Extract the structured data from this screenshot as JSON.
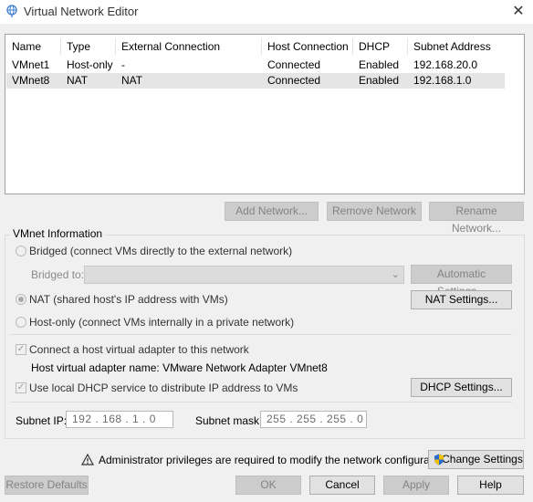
{
  "window": {
    "title": "Virtual Network Editor",
    "close_glyph": "✕",
    "icon": "network-globe-icon"
  },
  "table": {
    "columns": [
      "Name",
      "Type",
      "External Connection",
      "Host Connection",
      "DHCP",
      "Subnet Address"
    ],
    "rows": [
      {
        "name": "VMnet1",
        "type": "Host-only",
        "external": "-",
        "host": "Connected",
        "dhcp": "Enabled",
        "subnet": "192.168.20.0"
      },
      {
        "name": "VMnet8",
        "type": "NAT",
        "external": "NAT",
        "host": "Connected",
        "dhcp": "Enabled",
        "subnet": "192.168.1.0"
      }
    ],
    "selected_row": 1
  },
  "table_buttons": {
    "add": "Add Network...",
    "remove": "Remove Network",
    "rename": "Rename Network..."
  },
  "vmnet_info": {
    "group_label": "VMnet Information",
    "bridged_label": "Bridged (connect VMs directly to the external network)",
    "bridged_to_label": "Bridged to:",
    "bridged_to_value": "",
    "auto_settings": "Automatic Settings...",
    "nat_label": "NAT (shared host's IP address with VMs)",
    "nat_settings": "NAT Settings...",
    "hostonly_label": "Host-only (connect VMs internally in a private network)",
    "selected_mode": "nat",
    "connect_adapter_label": "Connect a host virtual adapter to this network",
    "connect_adapter_checked": true,
    "adapter_name_label": "Host virtual adapter name: VMware Network Adapter VMnet8",
    "dhcp_label": "Use local DHCP service to distribute IP address to VMs",
    "dhcp_checked": true,
    "dhcp_settings": "DHCP Settings...",
    "subnet_ip_label": "Subnet IP:",
    "subnet_ip": "192 . 168 .  1  .  0",
    "subnet_mask_label": "Subnet mask:",
    "subnet_mask": "255 . 255 . 255 .  0"
  },
  "admin": {
    "warning_text": "Administrator privileges are required to modify the network configuration.",
    "change_settings": "Change Settings"
  },
  "footer": {
    "restore": "Restore Defaults",
    "ok": "OK",
    "cancel": "Cancel",
    "apply": "Apply",
    "help": "Help"
  },
  "colors": {
    "selected_row": "#e5e5e5",
    "accent": "#0078d7",
    "window_bg": "#f0f0f0"
  }
}
